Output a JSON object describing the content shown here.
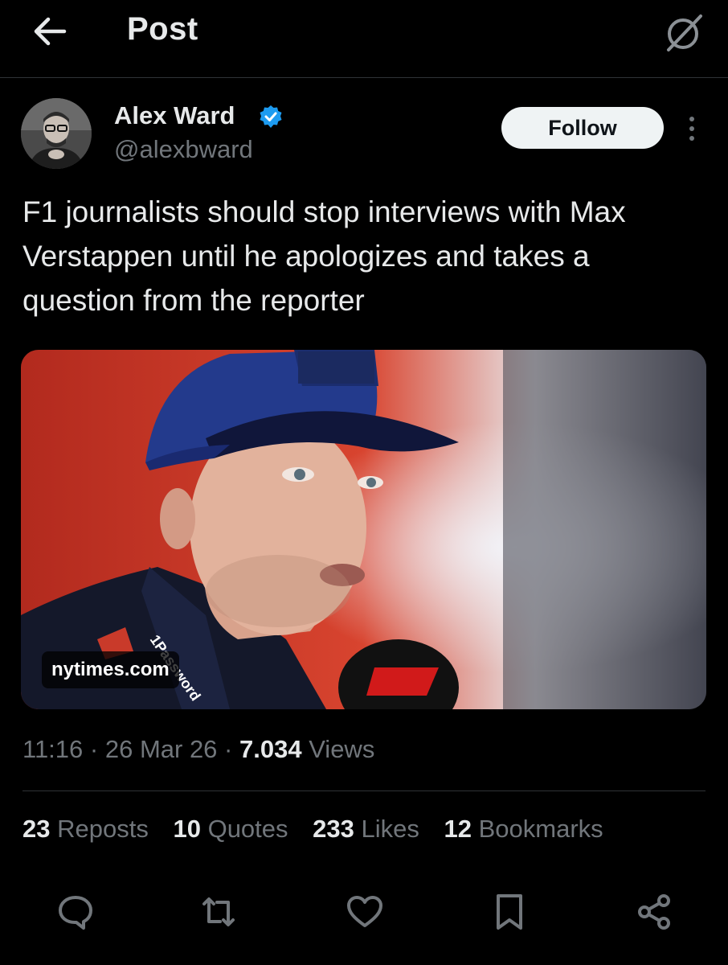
{
  "header": {
    "title": "Post"
  },
  "author": {
    "name": "Alex Ward",
    "handle": "@alexbward",
    "follow_label": "Follow"
  },
  "tweet": {
    "text": "F1 journalists should stop interviews with Max Verstappen until he apologizes and takes a question from the reporter"
  },
  "media": {
    "source_label": "nytimes.com"
  },
  "meta": {
    "time": "11:16",
    "date": "26 Mar 26",
    "views_count": "7.034",
    "views_label": "Views"
  },
  "stats": {
    "reposts_count": "23",
    "reposts_label": "Reposts",
    "quotes_count": "10",
    "quotes_label": "Quotes",
    "likes_count": "233",
    "likes_label": "Likes",
    "bookmarks_count": "12",
    "bookmarks_label": "Bookmarks"
  },
  "icons": {
    "back": "back-arrow-icon",
    "grok": "grok-icon",
    "verified": "verified-badge-icon",
    "more": "more-options-icon",
    "reply": "reply-icon",
    "repost": "repost-icon",
    "like": "heart-icon",
    "bookmark": "bookmark-icon",
    "share": "share-icon"
  },
  "colors": {
    "background": "#000000",
    "text_primary": "#e7e9ea",
    "text_secondary": "#71767b",
    "verified": "#1d9bf0",
    "follow_bg": "#eff3f4"
  }
}
